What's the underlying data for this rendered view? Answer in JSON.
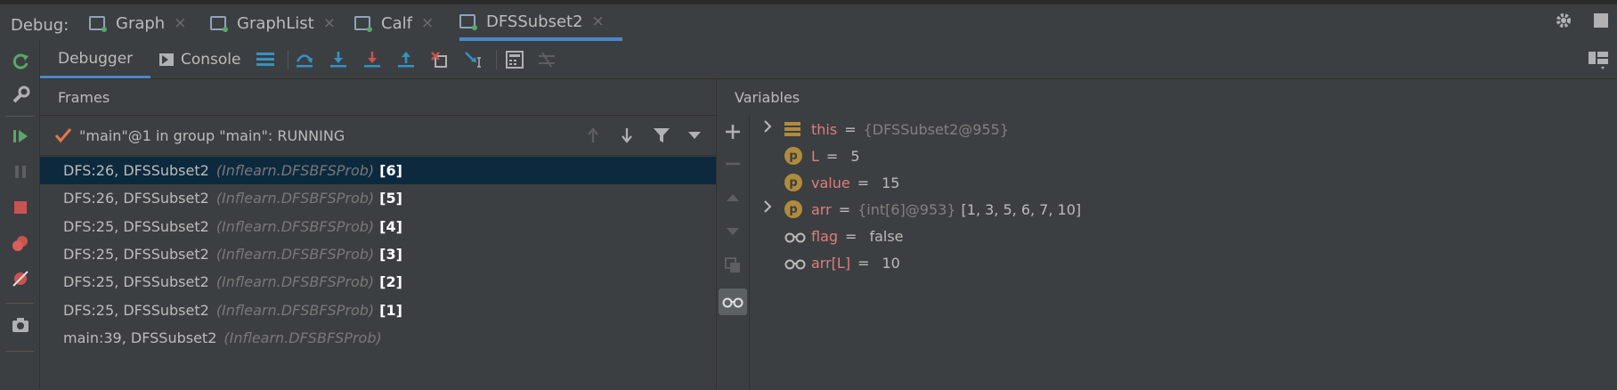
{
  "debug_label": "Debug:",
  "tabs": [
    {
      "label": "Graph"
    },
    {
      "label": "GraphList"
    },
    {
      "label": "Calf"
    },
    {
      "label": "DFSSubset2"
    }
  ],
  "close_glyph": "×",
  "subtabs": {
    "debugger": "Debugger",
    "console": "Console"
  },
  "frames": {
    "header": "Frames",
    "thread": "\"main\"@1 in group \"main\": RUNNING",
    "rows": [
      {
        "loc": "DFS:26, DFSSubset2",
        "pkg": "(Inflearn.DFSBFSProb)",
        "num": "[6]"
      },
      {
        "loc": "DFS:26, DFSSubset2",
        "pkg": "(Inflearn.DFSBFSProb)",
        "num": "[5]"
      },
      {
        "loc": "DFS:25, DFSSubset2",
        "pkg": "(Inflearn.DFSBFSProb)",
        "num": "[4]"
      },
      {
        "loc": "DFS:25, DFSSubset2",
        "pkg": "(Inflearn.DFSBFSProb)",
        "num": "[3]"
      },
      {
        "loc": "DFS:25, DFSSubset2",
        "pkg": "(Inflearn.DFSBFSProb)",
        "num": "[2]"
      },
      {
        "loc": "DFS:25, DFSSubset2",
        "pkg": "(Inflearn.DFSBFSProb)",
        "num": "[1]"
      },
      {
        "loc": "main:39, DFSSubset2",
        "pkg": "(Inflearn.DFSBFSProb)",
        "num": ""
      }
    ]
  },
  "variables": {
    "header": "Variables",
    "items": [
      {
        "name": "this",
        "eq": "=",
        "type": "{DFSSubset2@955}",
        "value": "",
        "icon": "object-icon",
        "letter": ""
      },
      {
        "name": "L",
        "eq": "=",
        "type": "",
        "value": "5",
        "icon": "parameter-icon",
        "letter": "p"
      },
      {
        "name": "value",
        "eq": "=",
        "type": "",
        "value": "15",
        "icon": "parameter-icon",
        "letter": "p"
      },
      {
        "name": "arr",
        "eq": "=",
        "type": "{int[6]@953}",
        "value": "[1, 3, 5, 6, 7, 10]",
        "icon": "parameter-icon",
        "letter": "p"
      },
      {
        "name": "flag",
        "eq": "=",
        "type": "",
        "value": "false",
        "icon": "watch-icon",
        "letter": ""
      },
      {
        "name": "arr[L]",
        "eq": "=",
        "type": "",
        "value": "10",
        "icon": "watch-icon",
        "letter": ""
      }
    ]
  },
  "colors": {
    "accent": "#4a88c7",
    "selected_row": "#0d293e",
    "var_name": "#e07c7c",
    "param_icon": "#b08b3c",
    "check": "#e8754a",
    "green": "#59a869",
    "red": "#c75450"
  }
}
